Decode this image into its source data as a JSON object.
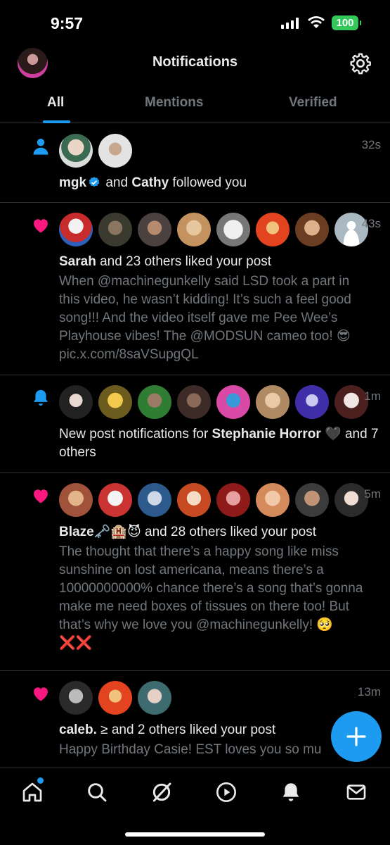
{
  "status_bar": {
    "time": "9:57",
    "battery": "100"
  },
  "header": {
    "title": "Notifications"
  },
  "tabs": [
    {
      "label": "All",
      "active": true
    },
    {
      "label": "Mentions",
      "active": false
    },
    {
      "label": "Verified",
      "active": false
    }
  ],
  "notifications": [
    {
      "type": "follow",
      "icon": "person-icon",
      "time": "32s",
      "name1": "mgk",
      "connector": " and ",
      "name2": "Cathy",
      "action": " followed you"
    },
    {
      "type": "like",
      "icon": "heart-icon",
      "time": "43s",
      "name": "Sarah",
      "action": " and 23 others liked your post",
      "body": "When @machinegunkelly said LSD took a part in this video, he wasn’t kidding! It’s such a feel good song!!! And the video itself gave me Pee Wee’s Playhouse vibes! The @MODSUN cameo too! 😎 pic.x.com/8saVSupgQL"
    },
    {
      "type": "new-post",
      "icon": "bell-icon",
      "time": "1m",
      "prefix": "New post notifications for ",
      "name": "Stephanie Horror",
      "suffix": " 🖤 and 7 others"
    },
    {
      "type": "like",
      "icon": "heart-icon",
      "time": "5m",
      "name": "Blaze🗝️🏨😈",
      "action": " and 28 others liked your post",
      "body": "The thought that there’s a happy song like miss sunshine on lost americana, means there’s a 10000000000% chance there’s a song that’s gonna make me need boxes of tissues on there too! But that’s why we love you @machinegunkelly! 🥺❌❌"
    },
    {
      "type": "like",
      "icon": "heart-icon",
      "time": "13m",
      "name": "caleb.",
      "action": " ≥ and 2 others liked your post",
      "body": "Happy Birthday Casie! EST loves you so mu"
    }
  ],
  "colors": {
    "accent": "#1d9bf0",
    "like": "#f91880",
    "muted": "#71767b",
    "text": "#e7e9ea"
  }
}
